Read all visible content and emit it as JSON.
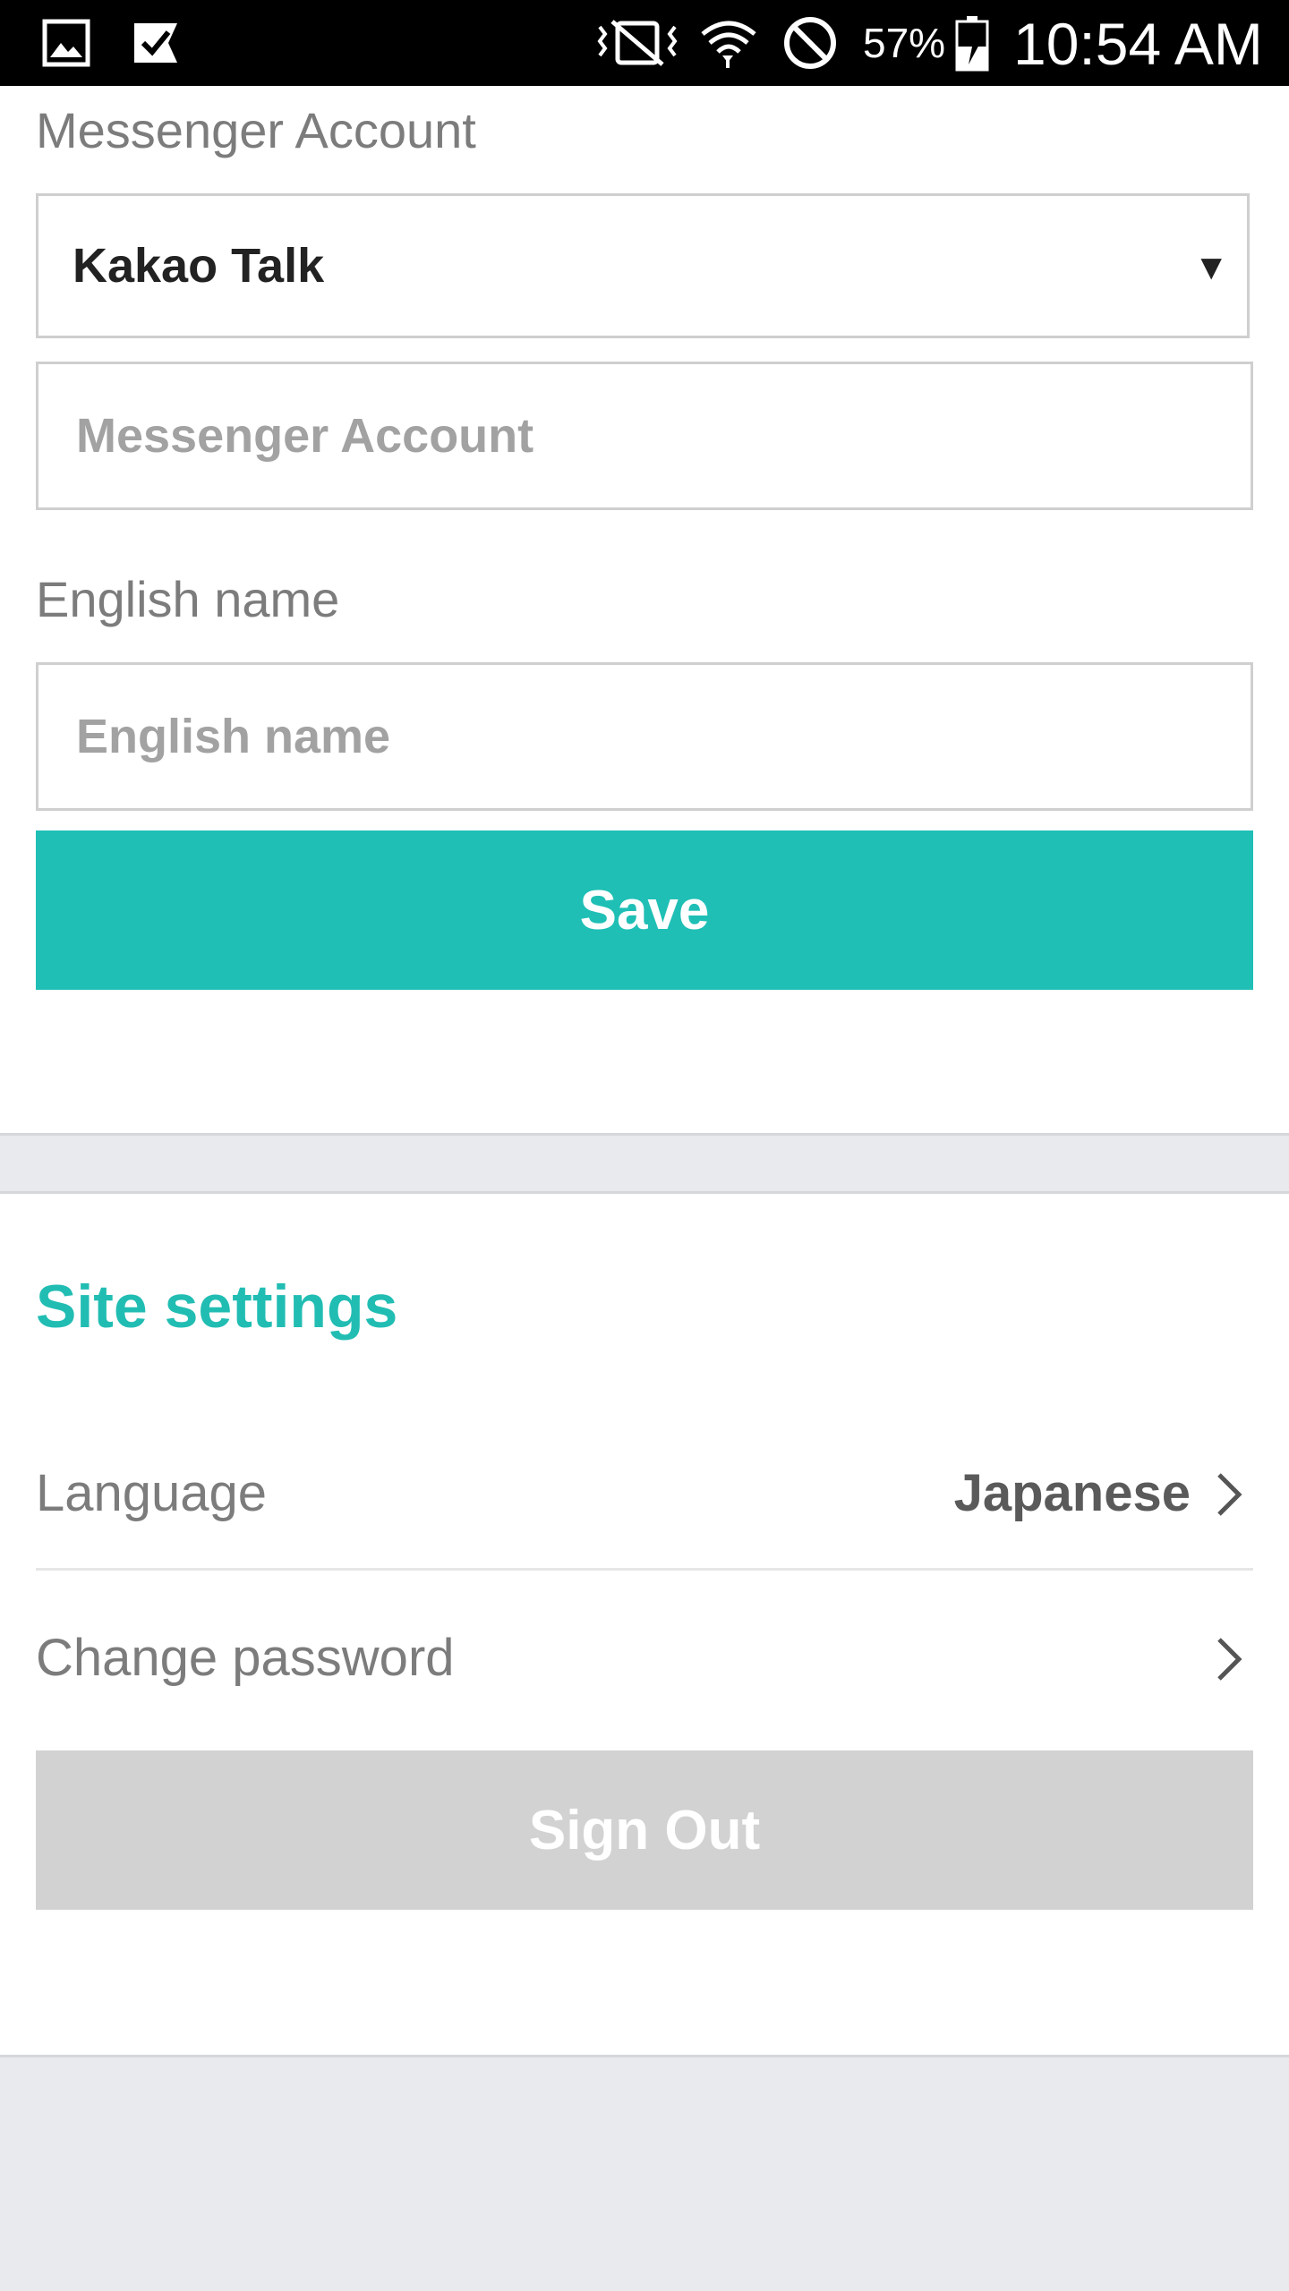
{
  "status_bar": {
    "battery_percent": "57%",
    "time": "10:54 AM",
    "icons": [
      "gallery-icon",
      "task-check-icon",
      "vibrate-icon",
      "wifi-icon",
      "do-not-disturb-icon",
      "battery-charging-icon"
    ]
  },
  "profile": {
    "messenger_label": "Messenger Account",
    "messenger_type": "Kakao Talk",
    "messenger_placeholder": "Messenger Account",
    "english_name_label": "English name",
    "english_name_placeholder": "English name",
    "save_label": "Save"
  },
  "site_settings": {
    "title": "Site settings",
    "language_label": "Language",
    "language_value": "Japanese",
    "change_password_label": "Change password",
    "sign_out_label": "Sign Out"
  },
  "colors": {
    "accent": "#1fbfb5",
    "disabled_button": "#d2d2d2",
    "background": "#e9eaee"
  }
}
